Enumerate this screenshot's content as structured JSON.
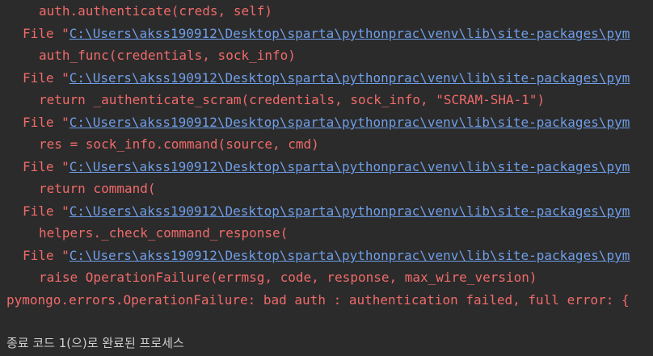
{
  "console": {
    "lines": [
      {
        "kind": "code",
        "text": "auth.authenticate(creds, self)"
      },
      {
        "kind": "file",
        "prefix": "File \"",
        "path": "C:\\Users\\akss190912\\Desktop\\sparta\\pythonprac\\venv\\lib\\site-packages\\pym"
      },
      {
        "kind": "code",
        "text": "auth_func(credentials, sock_info)"
      },
      {
        "kind": "file",
        "prefix": "File \"",
        "path": "C:\\Users\\akss190912\\Desktop\\sparta\\pythonprac\\venv\\lib\\site-packages\\pym"
      },
      {
        "kind": "code",
        "text": "return _authenticate_scram(credentials, sock_info, \"SCRAM-SHA-1\")"
      },
      {
        "kind": "file",
        "prefix": "File \"",
        "path": "C:\\Users\\akss190912\\Desktop\\sparta\\pythonprac\\venv\\lib\\site-packages\\pym"
      },
      {
        "kind": "code",
        "text": "res = sock_info.command(source, cmd)"
      },
      {
        "kind": "file",
        "prefix": "File \"",
        "path": "C:\\Users\\akss190912\\Desktop\\sparta\\pythonprac\\venv\\lib\\site-packages\\pym"
      },
      {
        "kind": "code",
        "text": "return command("
      },
      {
        "kind": "file",
        "prefix": "File \"",
        "path": "C:\\Users\\akss190912\\Desktop\\sparta\\pythonprac\\venv\\lib\\site-packages\\pym"
      },
      {
        "kind": "code",
        "text": "helpers._check_command_response("
      },
      {
        "kind": "file",
        "prefix": "File \"",
        "path": "C:\\Users\\akss190912\\Desktop\\sparta\\pythonprac\\venv\\lib\\site-packages\\pym"
      },
      {
        "kind": "code",
        "text": "raise OperationFailure(errmsg, code, response, max_wire_version)"
      },
      {
        "kind": "error",
        "text": "pymongo.errors.OperationFailure: bad auth : authentication failed, full error: {"
      },
      {
        "kind": "blank",
        "text": ""
      },
      {
        "kind": "exit",
        "text": "종료 코드 1(으)로 완료된 프로세스"
      }
    ]
  },
  "colors": {
    "background": "#2b2b2b",
    "error_text": "#f06a6a",
    "link": "#6f9ee8",
    "exit_text": "#cfcfcf"
  }
}
